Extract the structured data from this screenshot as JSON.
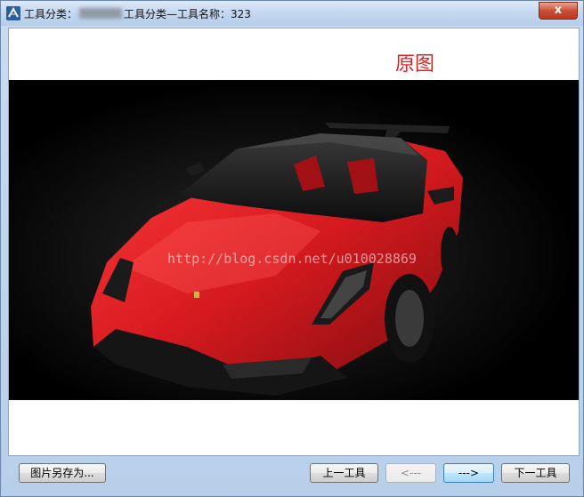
{
  "window": {
    "title_prefix": "工具分类：",
    "title_suffix": "工具分类—工具名称：323",
    "close_label": "x"
  },
  "content": {
    "caption": "原图",
    "watermark": "http://blog.csdn.net/u010028869"
  },
  "buttons": {
    "save_as": "图片另存为...",
    "prev_tool": "上一工具",
    "prev_image": "<---",
    "next_image": "--->",
    "next_tool": "下一工具"
  },
  "colors": {
    "caption": "#e02020",
    "car_body": "#d51a1f",
    "photo_background": "#000000"
  }
}
